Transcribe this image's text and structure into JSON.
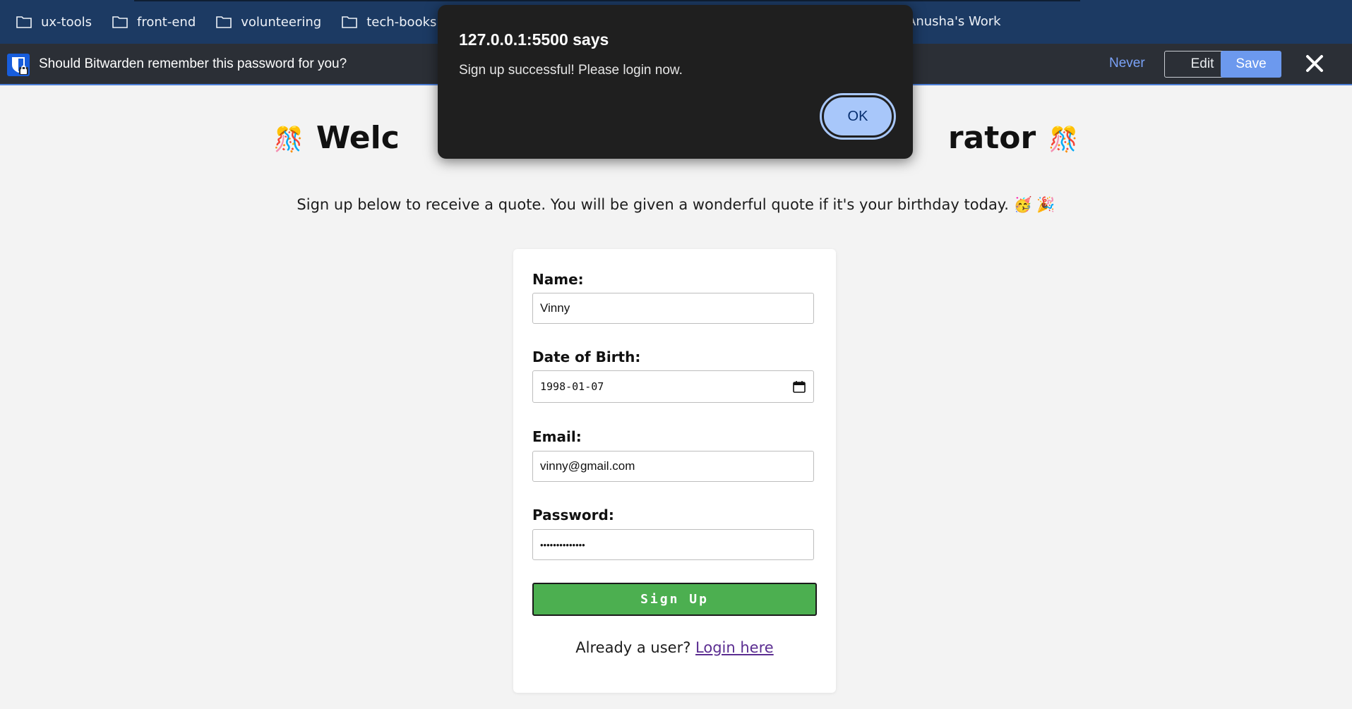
{
  "bookmarks": [
    {
      "label": "ux-tools",
      "icon": "folder-icon"
    },
    {
      "label": "front-end",
      "icon": "folder-icon"
    },
    {
      "label": "volunteering",
      "icon": "folder-icon"
    },
    {
      "label": "tech-books",
      "icon": "folder-icon"
    },
    {
      "label": "Anusha's Work",
      "icon": "folder-icon"
    }
  ],
  "bitwarden": {
    "message": "Should Bitwarden remember this password for you?",
    "never_label": "Never",
    "edit_label": "Edit",
    "save_label": "Save"
  },
  "page": {
    "title_left": "Welc",
    "title_right": "rator",
    "confetti": "🎊",
    "subtitle": "Sign up below to receive a quote. You will be given a wonderful quote if it's your birthday today. 🥳 🎉"
  },
  "form": {
    "name_label": "Name:",
    "name_value": "Vinny",
    "dob_label": "Date of Birth:",
    "dob_value": "1998-01-07",
    "email_label": "Email:",
    "email_value": "vinny@gmail.com",
    "password_label": "Password:",
    "password_value": "••••••••••••••",
    "signup_label": "Sign Up",
    "already_text": "Already a user? ",
    "login_link": "Login here"
  },
  "dialog": {
    "title": "127.0.0.1:5500 says",
    "message": "Sign up successful! Please login now.",
    "ok_label": "OK"
  },
  "colors": {
    "bookmarks_bg": "#1c3a63",
    "bitwarden_bg": "#2b2f36",
    "signup_green": "#4caf50",
    "dialog_bg": "#1f1f1f",
    "ok_button": "#a8c7fa"
  }
}
